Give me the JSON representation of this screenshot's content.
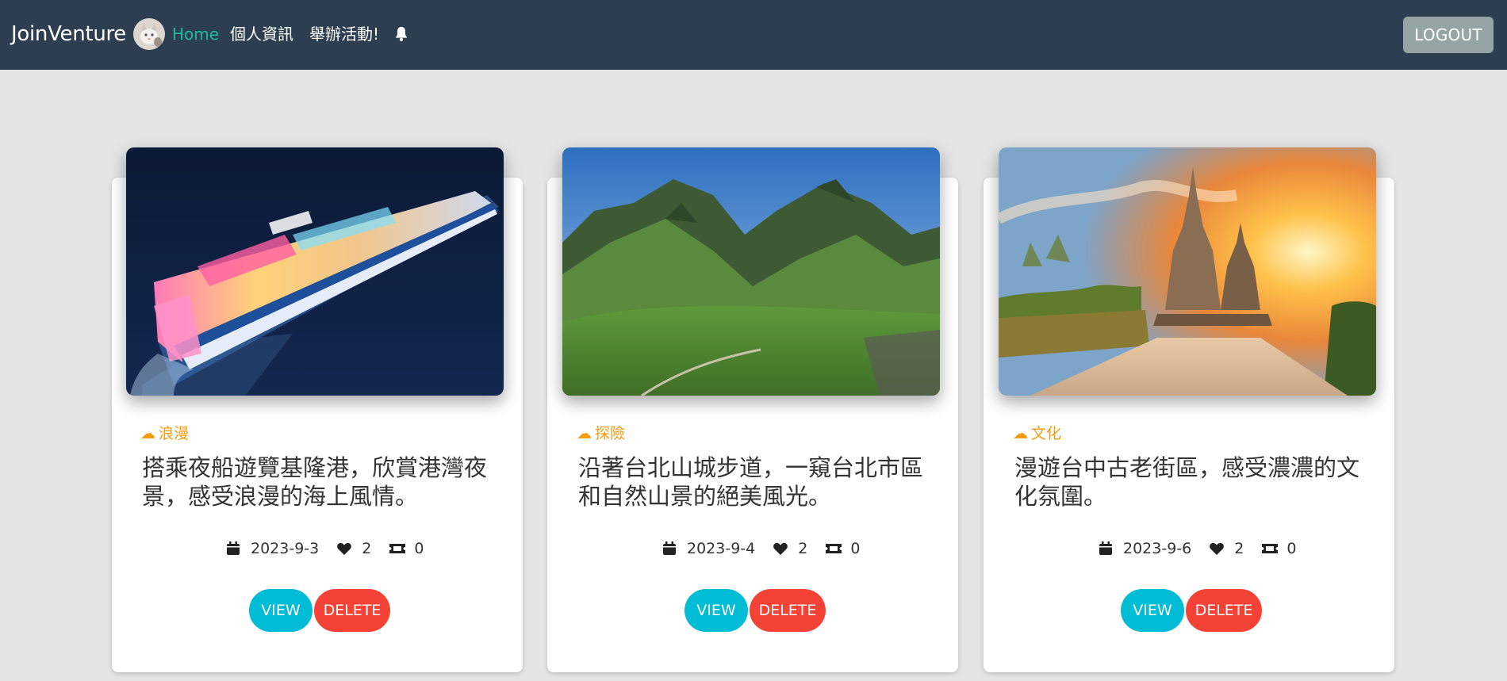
{
  "navbar": {
    "brand": "JoinVenture",
    "links": {
      "home": "Home",
      "profile": "個人資訊",
      "host": "舉辦活動!"
    },
    "logout_label": "LOGOUT",
    "colors": {
      "background": "#2c3e50",
      "active_link": "#1abc9c",
      "logout_button": "#95a5a6"
    },
    "icons": [
      "avatar",
      "bell-icon"
    ]
  },
  "cards": [
    {
      "image": "cruise-ship-photo",
      "category": "浪漫",
      "title": "搭乘夜船遊覽基隆港，欣賞港灣夜景，感受浪漫的海上風情。",
      "date": "2023-9-3",
      "likes": "2",
      "tickets": "0",
      "view_label": "VIEW",
      "delete_label": "DELETE"
    },
    {
      "image": "mountain-valley-photo",
      "category": "探險",
      "title": "沿著台北山城步道，一窺台北市區和自然山景的絕美風光。",
      "date": "2023-9-4",
      "likes": "2",
      "tickets": "0",
      "view_label": "VIEW",
      "delete_label": "DELETE"
    },
    {
      "image": "temple-sunset-photo",
      "category": "文化",
      "title": "漫遊台中古老街區，感受濃濃的文化氛圍。",
      "date": "2023-9-6",
      "likes": "2",
      "tickets": "0",
      "view_label": "VIEW",
      "delete_label": "DELETE"
    }
  ],
  "colors": {
    "page_background": "#e5e5e5",
    "category": "#f39c12",
    "view_button": "#00bcd4",
    "delete_button": "#f44336"
  },
  "meta_icons": [
    "calendar-icon",
    "heart-icon",
    "ticket-icon"
  ]
}
